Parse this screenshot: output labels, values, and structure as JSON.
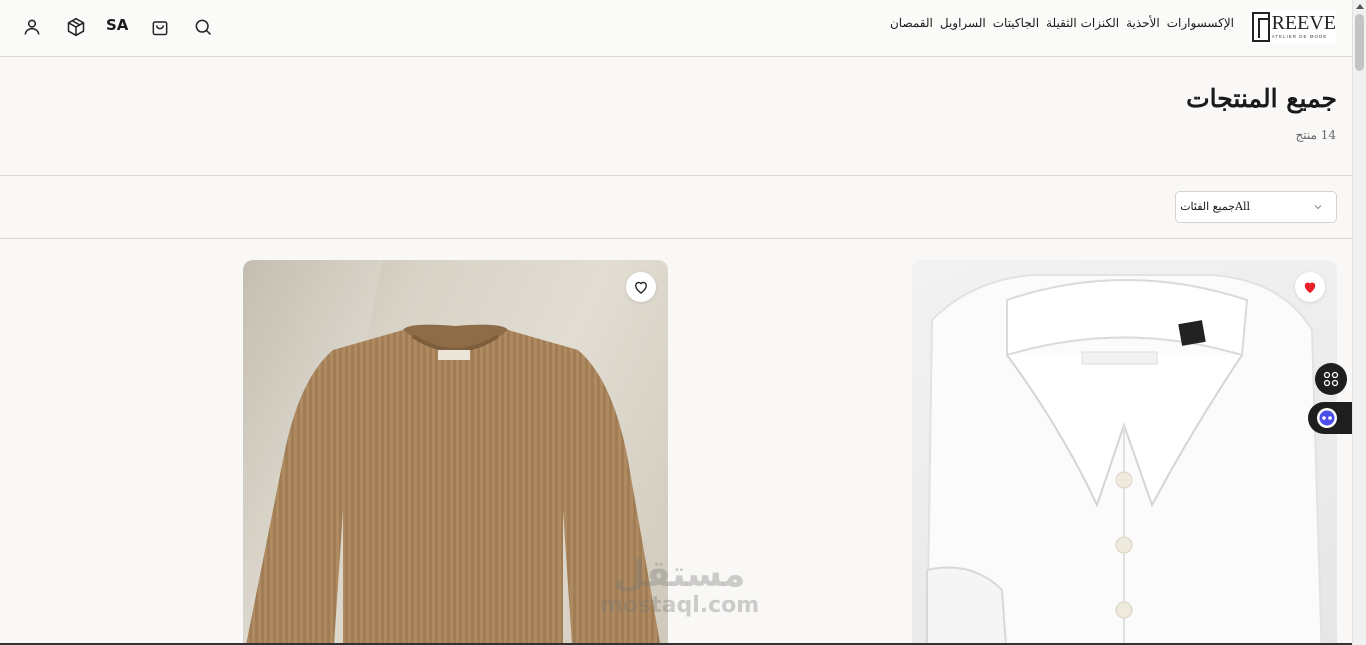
{
  "header": {
    "language": "SA",
    "nav": [
      "القمصان",
      "السراويل",
      "الجاكيتات",
      "الكنزات الثقيلة",
      "الأحذية",
      "الإكسسوارات"
    ],
    "logo": {
      "name": "REEVE",
      "tagline": "ATELIER DE MODE"
    }
  },
  "page": {
    "title": "جميع المنتجات",
    "count": "14 منتج"
  },
  "filter": {
    "selected": "Allجميع الفئات"
  },
  "products": [
    {
      "name": "sweater",
      "favorited": false
    },
    {
      "name": "shirt",
      "favorited": true
    }
  ],
  "watermark": {
    "line1": "مستقل",
    "line2": "mostaql.com"
  },
  "colors": {
    "favorite": "#e8202a",
    "background": "#f9f8f6",
    "widget": "#1e1e1e"
  }
}
